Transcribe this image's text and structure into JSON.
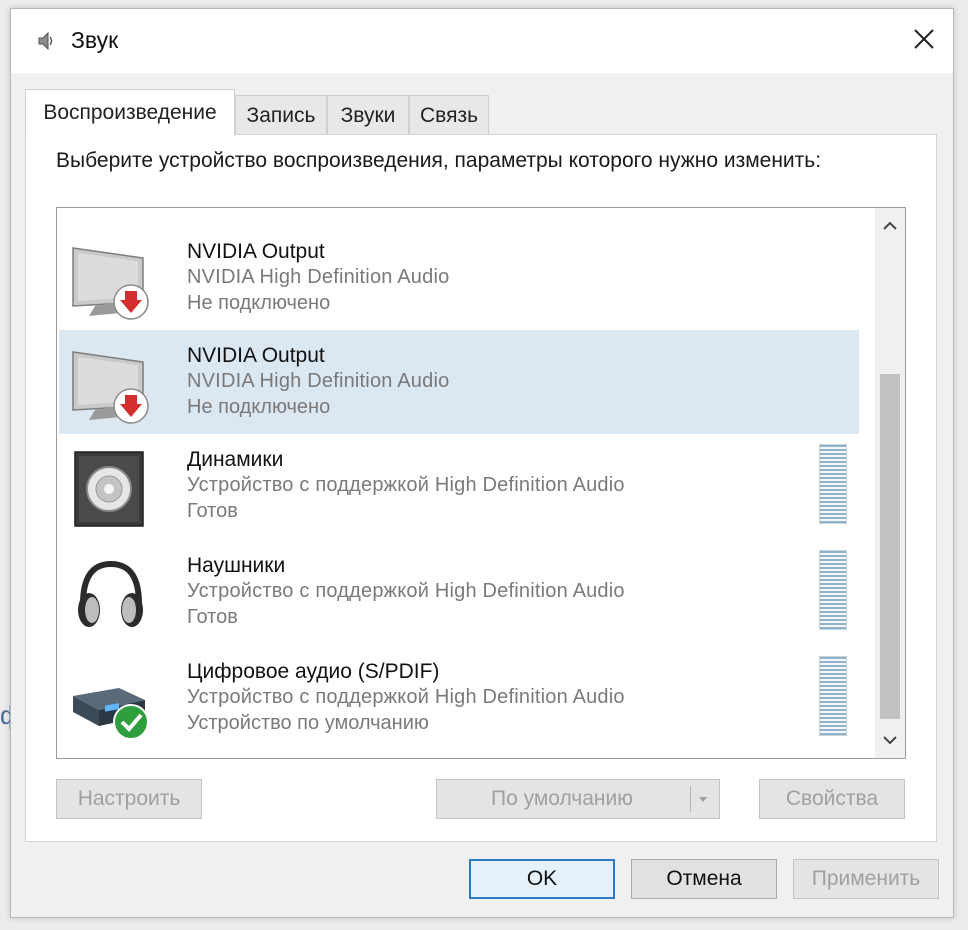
{
  "window": {
    "title": "Звук",
    "side_glyph": "ф"
  },
  "tabs": [
    {
      "label": "Воспроизведение",
      "active": true
    },
    {
      "label": "Запись",
      "active": false
    },
    {
      "label": "Звуки",
      "active": false
    },
    {
      "label": "Связь",
      "active": false
    }
  ],
  "instruction": "Выберите устройство воспроизведения, параметры которого нужно изменить:",
  "devices": [
    {
      "name": "NVIDIA Output",
      "description": "NVIDIA High Definition Audio",
      "status": "Не подключено",
      "icon": "monitor-disconnected-icon",
      "selected": false
    },
    {
      "name": "NVIDIA Output",
      "description": "NVIDIA High Definition Audio",
      "status": "Не подключено",
      "icon": "monitor-disconnected-icon",
      "selected": true
    },
    {
      "name": "Динамики",
      "description": "Устройство с поддержкой High Definition Audio",
      "status": "Готов",
      "icon": "speaker-icon",
      "selected": false
    },
    {
      "name": "Наушники",
      "description": "Устройство с поддержкой High Definition Audio",
      "status": "Готов",
      "icon": "headphones-icon",
      "selected": false
    },
    {
      "name": "Цифровое аудио (S/PDIF)",
      "description": "Устройство с поддержкой High Definition Audio",
      "status": "Устройство по умолчанию",
      "icon": "digital-audio-default-icon",
      "selected": false
    }
  ],
  "panel_buttons": {
    "configure": "Настроить",
    "set_default": "По умолчанию",
    "properties": "Свойства"
  },
  "dialog_buttons": {
    "ok": "OK",
    "cancel": "Отмена",
    "apply": "Применить"
  },
  "colors": {
    "selected_row": "#dbe7f1",
    "primary_border": "#2a7cc7",
    "disconnected_badge": "#d32f2f",
    "default_badge": "#2e9e3e"
  }
}
